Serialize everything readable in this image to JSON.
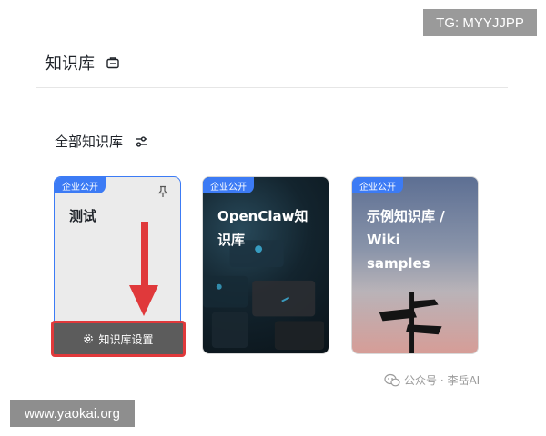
{
  "overlay": {
    "tg_label": "TG: MYYJJPP",
    "site_label": "www.yaokai.org"
  },
  "header": {
    "title": "知识库",
    "icon": "briefcase-icon"
  },
  "section": {
    "title": "全部知识库",
    "icon": "filter-sliders-icon"
  },
  "cards": [
    {
      "tag": "企业公开",
      "title": "测试",
      "pinned": true,
      "settings_label": "知识库设置"
    },
    {
      "tag": "企业公开",
      "title": "OpenClaw知识库"
    },
    {
      "tag": "企业公开",
      "title": "示例知识库 / Wiki samples"
    }
  ],
  "watermark": {
    "text": "公众号 · 李岳AI",
    "icon": "wechat-icon"
  },
  "colors": {
    "accent": "#3c7bf5",
    "highlight": "#e0393b"
  }
}
